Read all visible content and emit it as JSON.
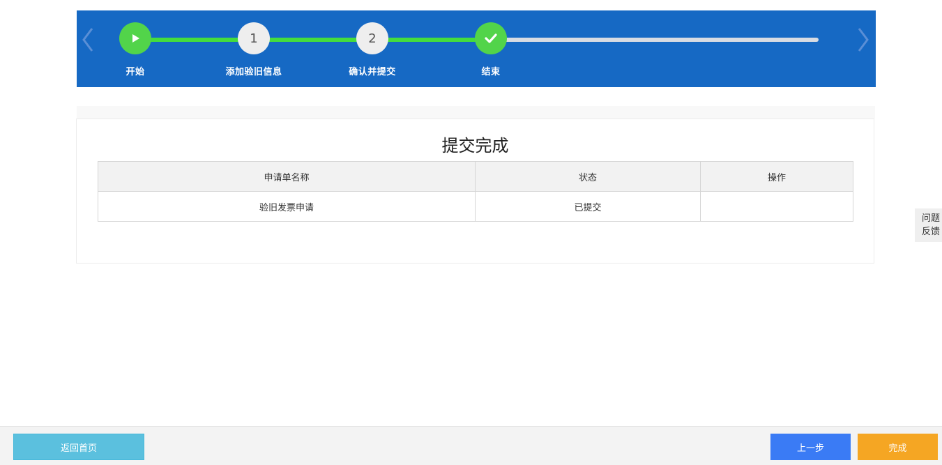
{
  "stepper": {
    "steps": [
      {
        "label": "开始",
        "marker": "play-icon",
        "state": "done"
      },
      {
        "label": "添加验旧信息",
        "marker": "1",
        "state": "done"
      },
      {
        "label": "确认并提交",
        "marker": "2",
        "state": "done"
      },
      {
        "label": "结束",
        "marker": "check-icon",
        "state": "current"
      }
    ],
    "colors": {
      "banner": "#1669c4",
      "done": "#52d44a",
      "pending": "#eeeeee"
    }
  },
  "result": {
    "title": "提交完成",
    "columns": [
      "申请单名称",
      "状态",
      "操作"
    ],
    "rows": [
      {
        "name": "验旧发票申请",
        "status": "已提交",
        "action": ""
      }
    ]
  },
  "feedback": {
    "line1": "问题",
    "line2": "反馈"
  },
  "footer": {
    "home_label": "返回首页",
    "prev_label": "上一步",
    "finish_label": "完成",
    "colors": {
      "home": "#5bc0de",
      "prev": "#3a7bf5",
      "finish": "#f5a623"
    }
  }
}
